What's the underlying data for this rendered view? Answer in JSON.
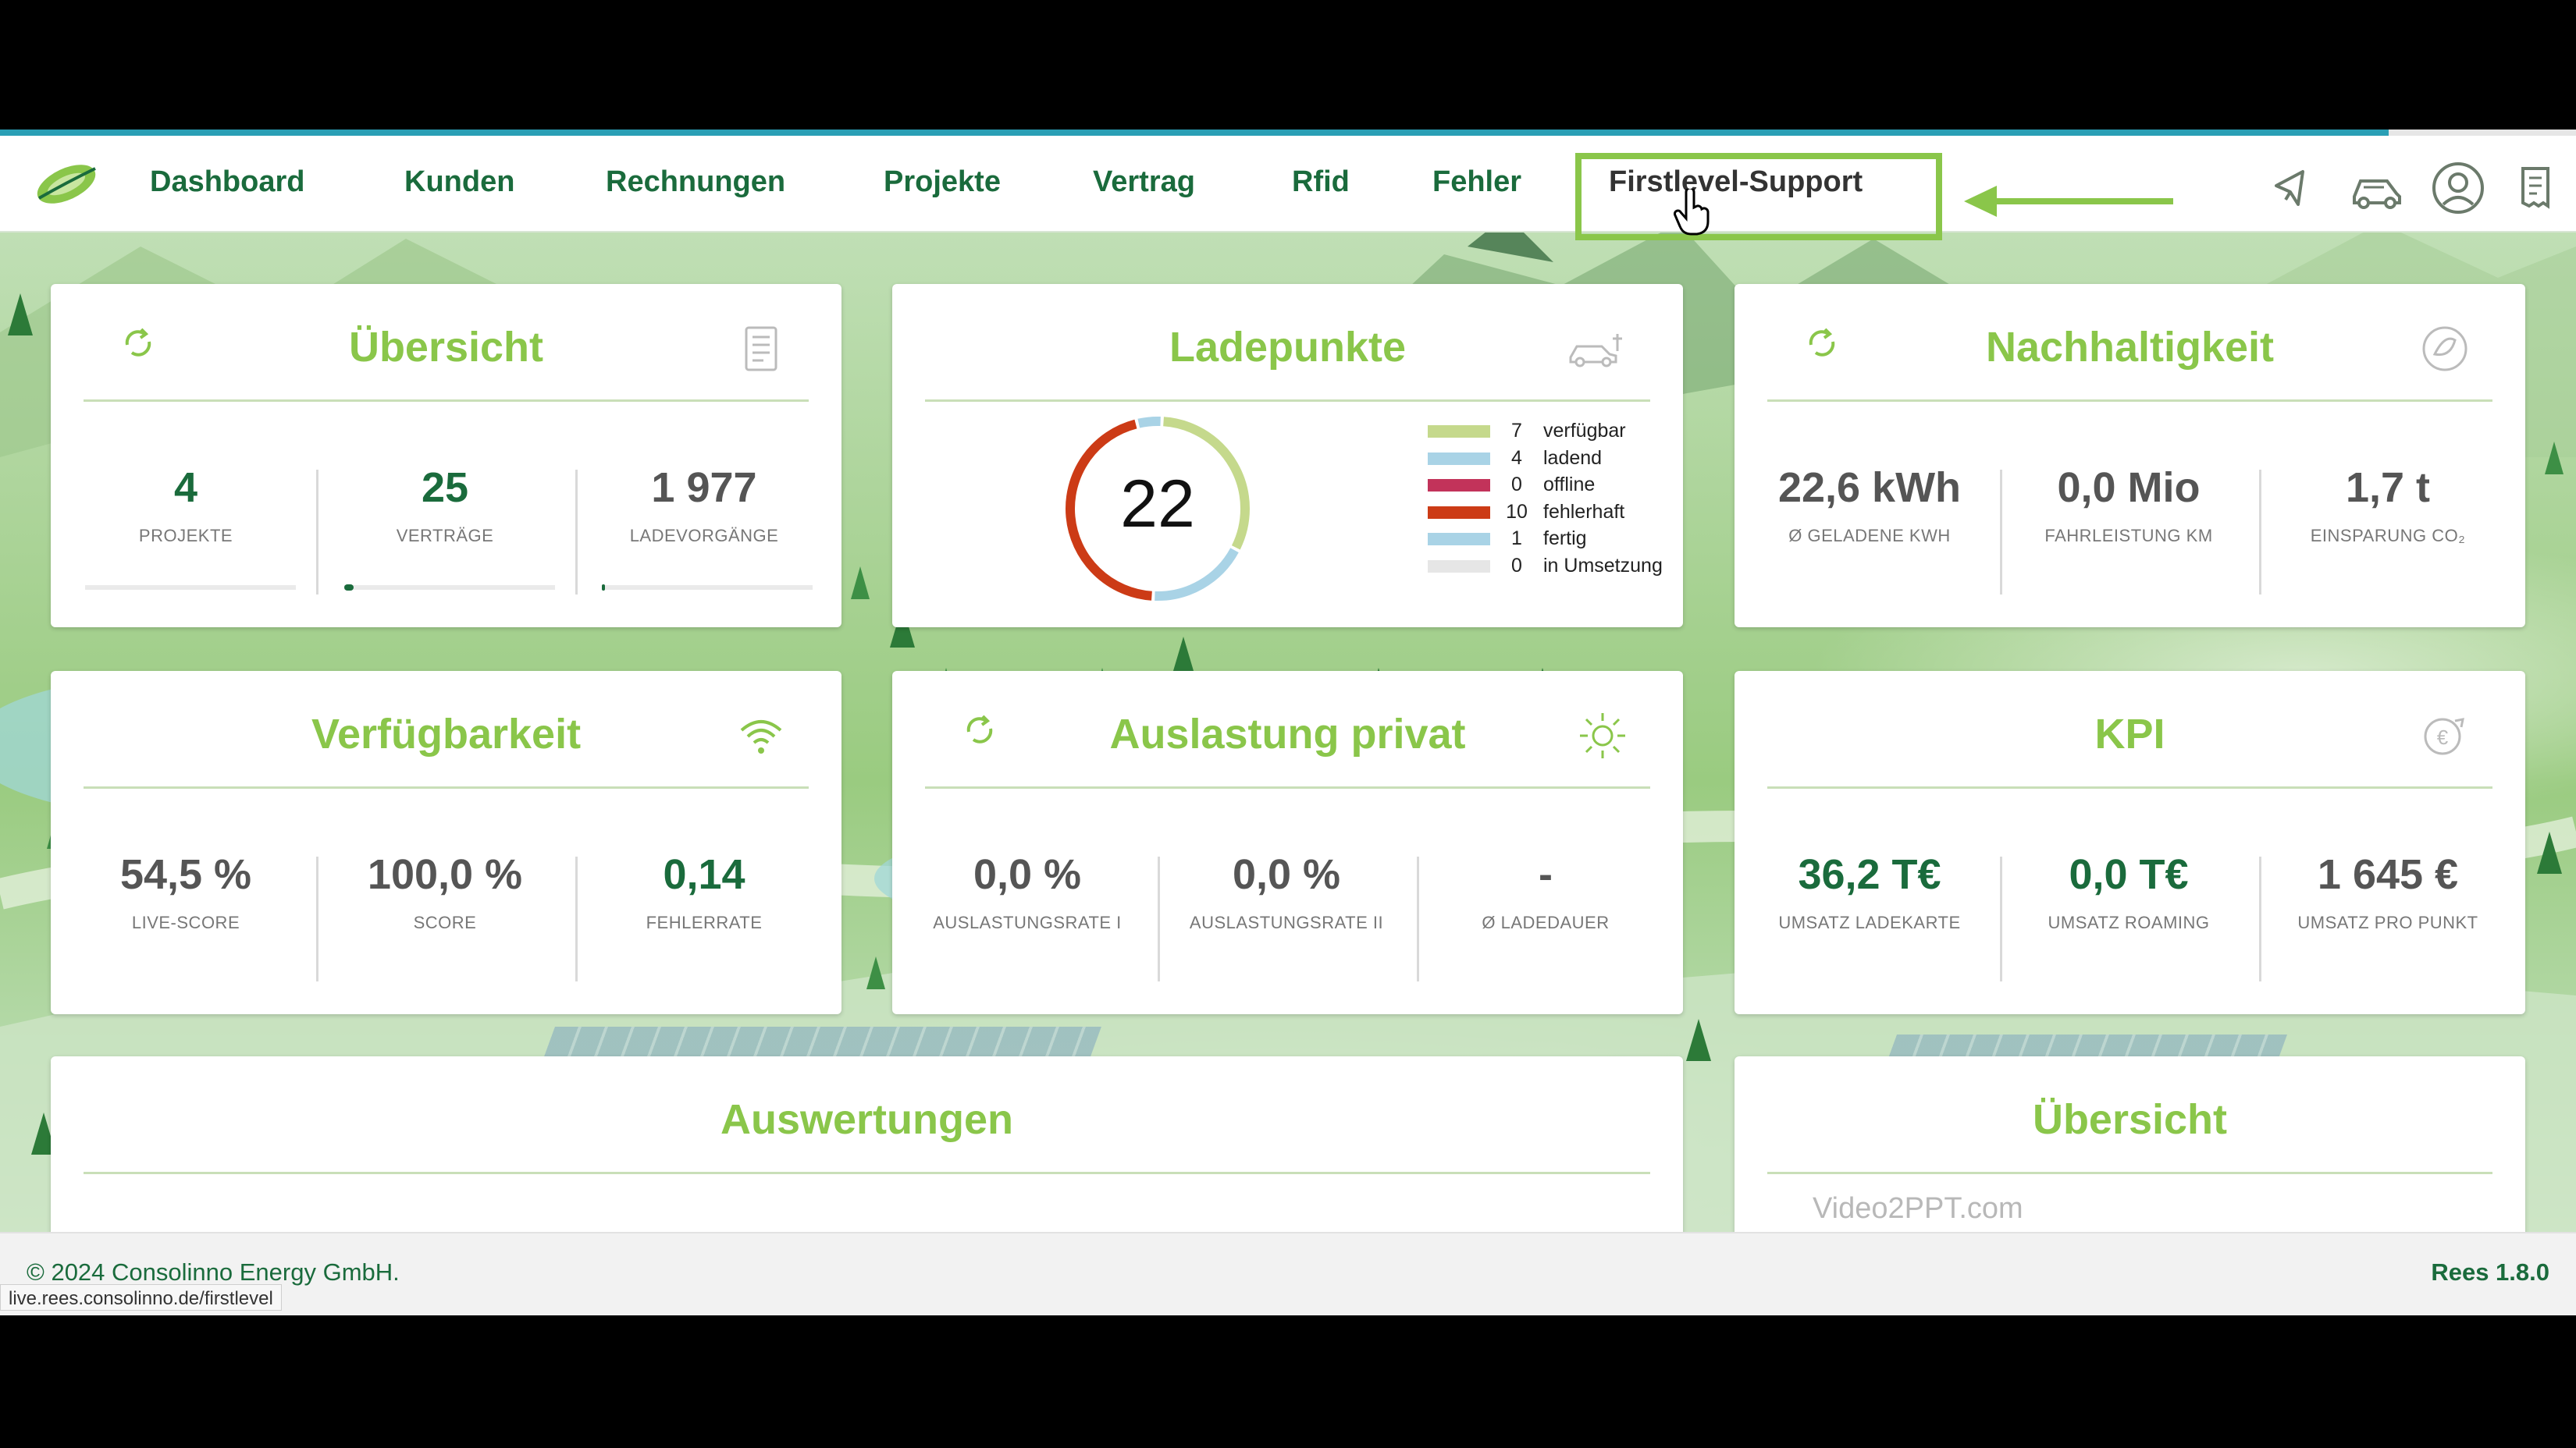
{
  "nav": {
    "items": [
      "Dashboard",
      "Kunden",
      "Rechnungen",
      "Projekte",
      "Vertrag",
      "Rfid",
      "Fehler",
      "Firstlevel-Support"
    ],
    "icons": [
      "megaphone-icon",
      "car-service-icon",
      "user-account-icon",
      "invoice-icon"
    ]
  },
  "cards": {
    "uebersicht": {
      "title": "Übersicht",
      "stats": [
        {
          "value": "4",
          "label": "PROJEKTE"
        },
        {
          "value": "25",
          "label": "VERTRÄGE"
        },
        {
          "value": "1 977",
          "label": "LADEVORGÄNGE"
        }
      ]
    },
    "ladepunkte": {
      "title": "Ladepunkte",
      "total": "22",
      "legend": [
        {
          "count": "7",
          "label": "verfügbar",
          "color": "#c5d98c"
        },
        {
          "count": "4",
          "label": "ladend",
          "color": "#a9d3e6"
        },
        {
          "count": "0",
          "label": "offline",
          "color": "#c2335a"
        },
        {
          "count": "10",
          "label": "fehlerhaft",
          "color": "#cc3b16"
        },
        {
          "count": "1",
          "label": "fertig",
          "color": "#a9d3e6"
        },
        {
          "count": "0",
          "label": "in Umsetzung",
          "color": "#e6e6e6"
        }
      ]
    },
    "nachhaltigkeit": {
      "title": "Nachhaltigkeit",
      "stats": [
        {
          "value": "22,6 kWh",
          "label": "Ø GELADENE KWH"
        },
        {
          "value": "0,0 Mio",
          "label": "FAHRLEISTUNG KM"
        },
        {
          "value": "1,7 t",
          "label": "EINSPARUNG CO₂"
        }
      ]
    },
    "verfuegbarkeit": {
      "title": "Verfügbarkeit",
      "stats": [
        {
          "value": "54,5 %",
          "label": "LIVE-SCORE"
        },
        {
          "value": "100,0 %",
          "label": "SCORE"
        },
        {
          "value": "0,14",
          "label": "FEHLERRATE"
        }
      ]
    },
    "auslastung": {
      "title": "Auslastung privat",
      "stats": [
        {
          "value": "0,0 %",
          "label": "AUSLASTUNGSRATE I"
        },
        {
          "value": "0,0 %",
          "label": "AUSLASTUNGSRATE II"
        },
        {
          "value": "-",
          "label": "Ø LADEDAUER"
        }
      ]
    },
    "kpi": {
      "title": "KPI",
      "stats": [
        {
          "value": "36,2 T€",
          "label": "UMSATZ LADEKARTE"
        },
        {
          "value": "0,0 T€",
          "label": "UMSATZ ROAMING"
        },
        {
          "value": "1 645 €",
          "label": "UMSATZ PRO PUNKT"
        }
      ]
    },
    "auswertungen": {
      "title": "Auswertungen"
    },
    "uebersicht2": {
      "title": "Übersicht"
    }
  },
  "watermark": "Video2PPT.com",
  "footer": {
    "copyright": "© 2024 Consolinno Energy GmbH.",
    "version": "Rees 1.8.0",
    "status_url": "live.rees.consolinno.de/firstlevel"
  },
  "colors": {
    "brand_green": "#1a6b3c",
    "accent_green": "#8ac64a",
    "progress_blue": "#2a9fb5"
  }
}
